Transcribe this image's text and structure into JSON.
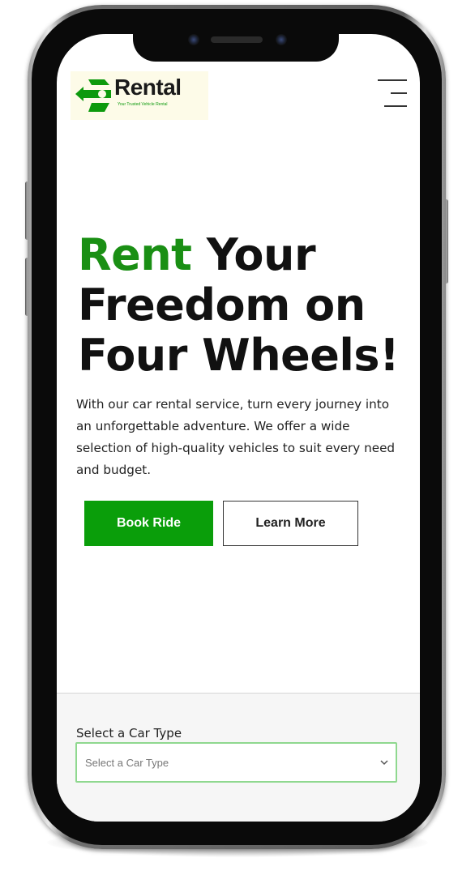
{
  "header": {
    "logo": {
      "brand": "Rental",
      "tagline": "Your Trusted Vehicle Rental"
    },
    "menu_icon": "hamburger-menu-icon"
  },
  "hero": {
    "title_accent": "Rent",
    "title_rest": " Your Freedom on Four Wheels!",
    "description": "With our car rental service, turn every journey into an unforgettable adventure. We offer a wide selection of high-quality vehicles to suit every need and budget.",
    "primary_button": "Book Ride",
    "secondary_button": "Learn More"
  },
  "booking": {
    "car_type_label": "Select a Car Type",
    "car_type_selected": "Select a Car Type"
  },
  "colors": {
    "accent_green": "#0a9e0a",
    "title_green": "#1a8f14",
    "select_border": "#8fd88f",
    "text_dark": "#111111"
  }
}
